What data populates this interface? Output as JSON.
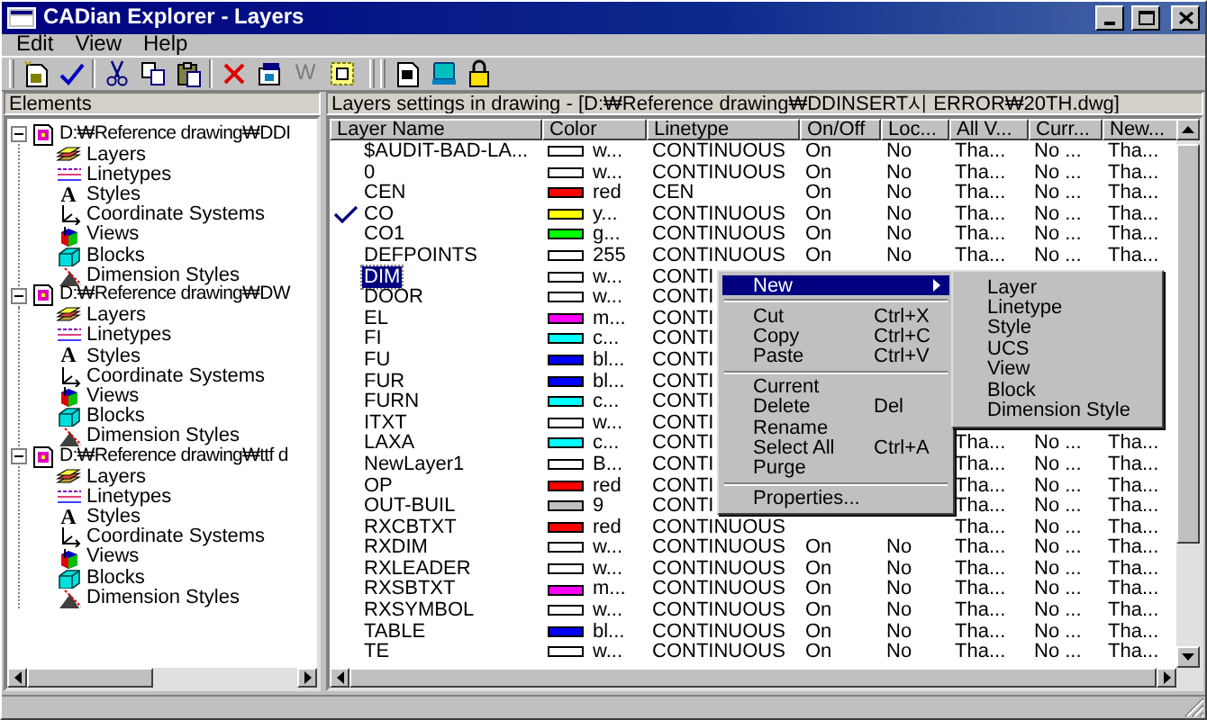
{
  "window": {
    "title": "CADian Explorer - Layers"
  },
  "menu_bar": [
    "Edit",
    "View",
    "Help"
  ],
  "toolbar": {
    "text_button": {
      "label": "W",
      "disabled": true
    }
  },
  "elements_panel": {
    "title": "Elements",
    "tree": [
      {
        "label": "D:₩Reference drawing₩DDI",
        "expanded": true,
        "children": [
          {
            "label": "Layers",
            "kind": "layers"
          },
          {
            "label": "Linetypes",
            "kind": "linetypes"
          },
          {
            "label": "Styles",
            "kind": "styles",
            "glyph": "A"
          },
          {
            "label": "Coordinate Systems",
            "kind": "ucs"
          },
          {
            "label": "Views",
            "kind": "views"
          },
          {
            "label": "Blocks",
            "kind": "blocks"
          },
          {
            "label": "Dimension Styles",
            "kind": "dimstyles"
          }
        ]
      },
      {
        "label": "D:₩Reference drawing₩DW",
        "expanded": true,
        "children": [
          {
            "label": "Layers",
            "kind": "layers"
          },
          {
            "label": "Linetypes",
            "kind": "linetypes"
          },
          {
            "label": "Styles",
            "kind": "styles",
            "glyph": "A"
          },
          {
            "label": "Coordinate Systems",
            "kind": "ucs"
          },
          {
            "label": "Views",
            "kind": "views"
          },
          {
            "label": "Blocks",
            "kind": "blocks"
          },
          {
            "label": "Dimension Styles",
            "kind": "dimstyles"
          }
        ]
      },
      {
        "label": "D:₩Reference drawing₩ttf d",
        "expanded": true,
        "children": [
          {
            "label": "Layers",
            "kind": "layers"
          },
          {
            "label": "Linetypes",
            "kind": "linetypes"
          },
          {
            "label": "Styles",
            "kind": "styles",
            "glyph": "A"
          },
          {
            "label": "Coordinate Systems",
            "kind": "ucs"
          },
          {
            "label": "Views",
            "kind": "views"
          },
          {
            "label": "Blocks",
            "kind": "blocks"
          },
          {
            "label": "Dimension Styles",
            "kind": "dimstyles"
          }
        ]
      }
    ]
  },
  "layers_panel": {
    "title": "Layers settings in drawing - [D:₩Reference drawing₩DDINSERT시 ERROR₩20TH.dwg]",
    "columns": [
      "Layer Name",
      "Color",
      "Linetype",
      "On/Off",
      "Loc...",
      "All V...",
      "Curr...",
      "New..."
    ],
    "rows": [
      {
        "name": "$AUDIT-BAD-LA...",
        "current": false,
        "selected": false,
        "color": "#ffffff",
        "color_name": "w...",
        "linetype": "CONTINUOUS",
        "on_off": "On",
        "lock": "No",
        "all_viewports": "Tha...",
        "current_viewport": "No ...",
        "new_viewports": "Tha..."
      },
      {
        "name": "0",
        "current": false,
        "selected": false,
        "color": "#ffffff",
        "color_name": "w...",
        "linetype": "CONTINUOUS",
        "on_off": "On",
        "lock": "No",
        "all_viewports": "Tha...",
        "current_viewport": "No ...",
        "new_viewports": "Tha..."
      },
      {
        "name": "CEN",
        "current": false,
        "selected": false,
        "color": "#ff0000",
        "color_name": "red",
        "linetype": "CEN",
        "on_off": "On",
        "lock": "No",
        "all_viewports": "Tha...",
        "current_viewport": "No ...",
        "new_viewports": "Tha..."
      },
      {
        "name": "CO",
        "current": true,
        "selected": false,
        "color": "#ffff00",
        "color_name": "y...",
        "linetype": "CONTINUOUS",
        "on_off": "On",
        "lock": "No",
        "all_viewports": "Tha...",
        "current_viewport": "No ...",
        "new_viewports": "Tha..."
      },
      {
        "name": "CO1",
        "current": false,
        "selected": false,
        "color": "#00ff00",
        "color_name": "g...",
        "linetype": "CONTINUOUS",
        "on_off": "On",
        "lock": "No",
        "all_viewports": "Tha...",
        "current_viewport": "No ...",
        "new_viewports": "Tha..."
      },
      {
        "name": "DEFPOINTS",
        "current": false,
        "selected": false,
        "color": "#ffffff",
        "color_name": "255",
        "linetype": "CONTINUOUS",
        "on_off": "On",
        "lock": "No",
        "all_viewports": "Tha...",
        "current_viewport": "No ...",
        "new_viewports": "Tha..."
      },
      {
        "name": "DIM",
        "current": false,
        "selected": true,
        "color": "#ffffff",
        "color_name": "w...",
        "linetype": "CONTI"
      },
      {
        "name": "DOOR",
        "current": false,
        "selected": false,
        "color": "#ffffff",
        "color_name": "w...",
        "linetype": "CONTI"
      },
      {
        "name": "EL",
        "current": false,
        "selected": false,
        "color": "#ff00ff",
        "color_name": "m...",
        "linetype": "CONTI"
      },
      {
        "name": "FI",
        "current": false,
        "selected": false,
        "color": "#00ffff",
        "color_name": "c...",
        "linetype": "CONTI"
      },
      {
        "name": "FU",
        "current": false,
        "selected": false,
        "color": "#0000ff",
        "color_name": "bl...",
        "linetype": "CONTI"
      },
      {
        "name": "FUR",
        "current": false,
        "selected": false,
        "color": "#0000ff",
        "color_name": "bl...",
        "linetype": "CONTI"
      },
      {
        "name": "FURN",
        "current": false,
        "selected": false,
        "color": "#00ffff",
        "color_name": "c...",
        "linetype": "CONTI"
      },
      {
        "name": "ITXT",
        "current": false,
        "selected": false,
        "color": "#ffffff",
        "color_name": "w...",
        "linetype": "CONTI"
      },
      {
        "name": "LAXA",
        "current": false,
        "selected": false,
        "color": "#00ffff",
        "color_name": "c...",
        "linetype": "CONTI",
        "all_viewports": "Tha...",
        "current_viewport": "No ...",
        "new_viewports": "Tha..."
      },
      {
        "name": "NewLayer1",
        "current": false,
        "selected": false,
        "color": "#ffffff",
        "color_name": "B...",
        "linetype": "CONTI",
        "all_viewports": "Tha...",
        "current_viewport": "No ...",
        "new_viewports": "Tha..."
      },
      {
        "name": "OP",
        "current": false,
        "selected": false,
        "color": "#ff0000",
        "color_name": "red",
        "linetype": "CONTI",
        "all_viewports": "Tha...",
        "current_viewport": "No ...",
        "new_viewports": "Tha..."
      },
      {
        "name": "OUT-BUIL",
        "current": false,
        "selected": false,
        "color": "#c0c0c0",
        "color_name": "9",
        "linetype": "CONTI",
        "all_viewports": "Tha...",
        "current_viewport": "No ...",
        "new_viewports": "Tha..."
      },
      {
        "name": "RXCBTXT",
        "current": false,
        "selected": false,
        "color": "#ff0000",
        "color_name": "red",
        "linetype": "CONTINUOUS",
        "all_viewports": "Tha...",
        "current_viewport": "No ...",
        "new_viewports": "Tha..."
      },
      {
        "name": "RXDIM",
        "current": false,
        "selected": false,
        "color": "#ffffff",
        "color_name": "w...",
        "linetype": "CONTINUOUS",
        "on_off": "On",
        "lock": "No",
        "all_viewports": "Tha...",
        "current_viewport": "No ...",
        "new_viewports": "Tha..."
      },
      {
        "name": "RXLEADER",
        "current": false,
        "selected": false,
        "color": "#ffffff",
        "color_name": "w...",
        "linetype": "CONTINUOUS",
        "on_off": "On",
        "lock": "No",
        "all_viewports": "Tha...",
        "current_viewport": "No ...",
        "new_viewports": "Tha..."
      },
      {
        "name": "RXSBTXT",
        "current": false,
        "selected": false,
        "color": "#ff00ff",
        "color_name": "m...",
        "linetype": "CONTINUOUS",
        "on_off": "On",
        "lock": "No",
        "all_viewports": "Tha...",
        "current_viewport": "No ...",
        "new_viewports": "Tha..."
      },
      {
        "name": "RXSYMBOL",
        "current": false,
        "selected": false,
        "color": "#ffffff",
        "color_name": "w...",
        "linetype": "CONTINUOUS",
        "on_off": "On",
        "lock": "No",
        "all_viewports": "Tha...",
        "current_viewport": "No ...",
        "new_viewports": "Tha..."
      },
      {
        "name": "TABLE",
        "current": false,
        "selected": false,
        "color": "#0000ff",
        "color_name": "bl...",
        "linetype": "CONTINUOUS",
        "on_off": "On",
        "lock": "No",
        "all_viewports": "Tha...",
        "current_viewport": "No ...",
        "new_viewports": "Tha..."
      },
      {
        "name": "TE",
        "current": false,
        "selected": false,
        "color": "#ffffff",
        "color_name": "w...",
        "linetype": "CONTINUOUS",
        "on_off": "On",
        "lock": "No",
        "all_viewports": "Tha...",
        "current_viewport": "No ...",
        "new_viewports": "Tha..."
      }
    ]
  },
  "context_menu": {
    "items": [
      {
        "kind": "item",
        "label": "New",
        "submenu": true,
        "selected": true
      },
      {
        "kind": "separator"
      },
      {
        "kind": "item",
        "label": "Cut",
        "shortcut": "Ctrl+X",
        "selected": false
      },
      {
        "kind": "item",
        "label": "Copy",
        "shortcut": "Ctrl+C",
        "selected": false
      },
      {
        "kind": "item",
        "label": "Paste",
        "shortcut": "Ctrl+V",
        "selected": false
      },
      {
        "kind": "separator"
      },
      {
        "kind": "item",
        "label": "Current",
        "selected": false
      },
      {
        "kind": "item",
        "label": "Delete",
        "shortcut": "Del",
        "selected": false
      },
      {
        "kind": "item",
        "label": "Rename",
        "selected": false
      },
      {
        "kind": "item",
        "label": "Select All",
        "shortcut": "Ctrl+A",
        "selected": false
      },
      {
        "kind": "item",
        "label": "Purge",
        "selected": false
      },
      {
        "kind": "separator"
      },
      {
        "kind": "item",
        "label": "Properties...",
        "selected": false
      }
    ]
  },
  "submenu": {
    "items": [
      "Layer",
      "Linetype",
      "Style",
      "UCS",
      "View",
      "Block",
      "Dimension Style"
    ]
  }
}
